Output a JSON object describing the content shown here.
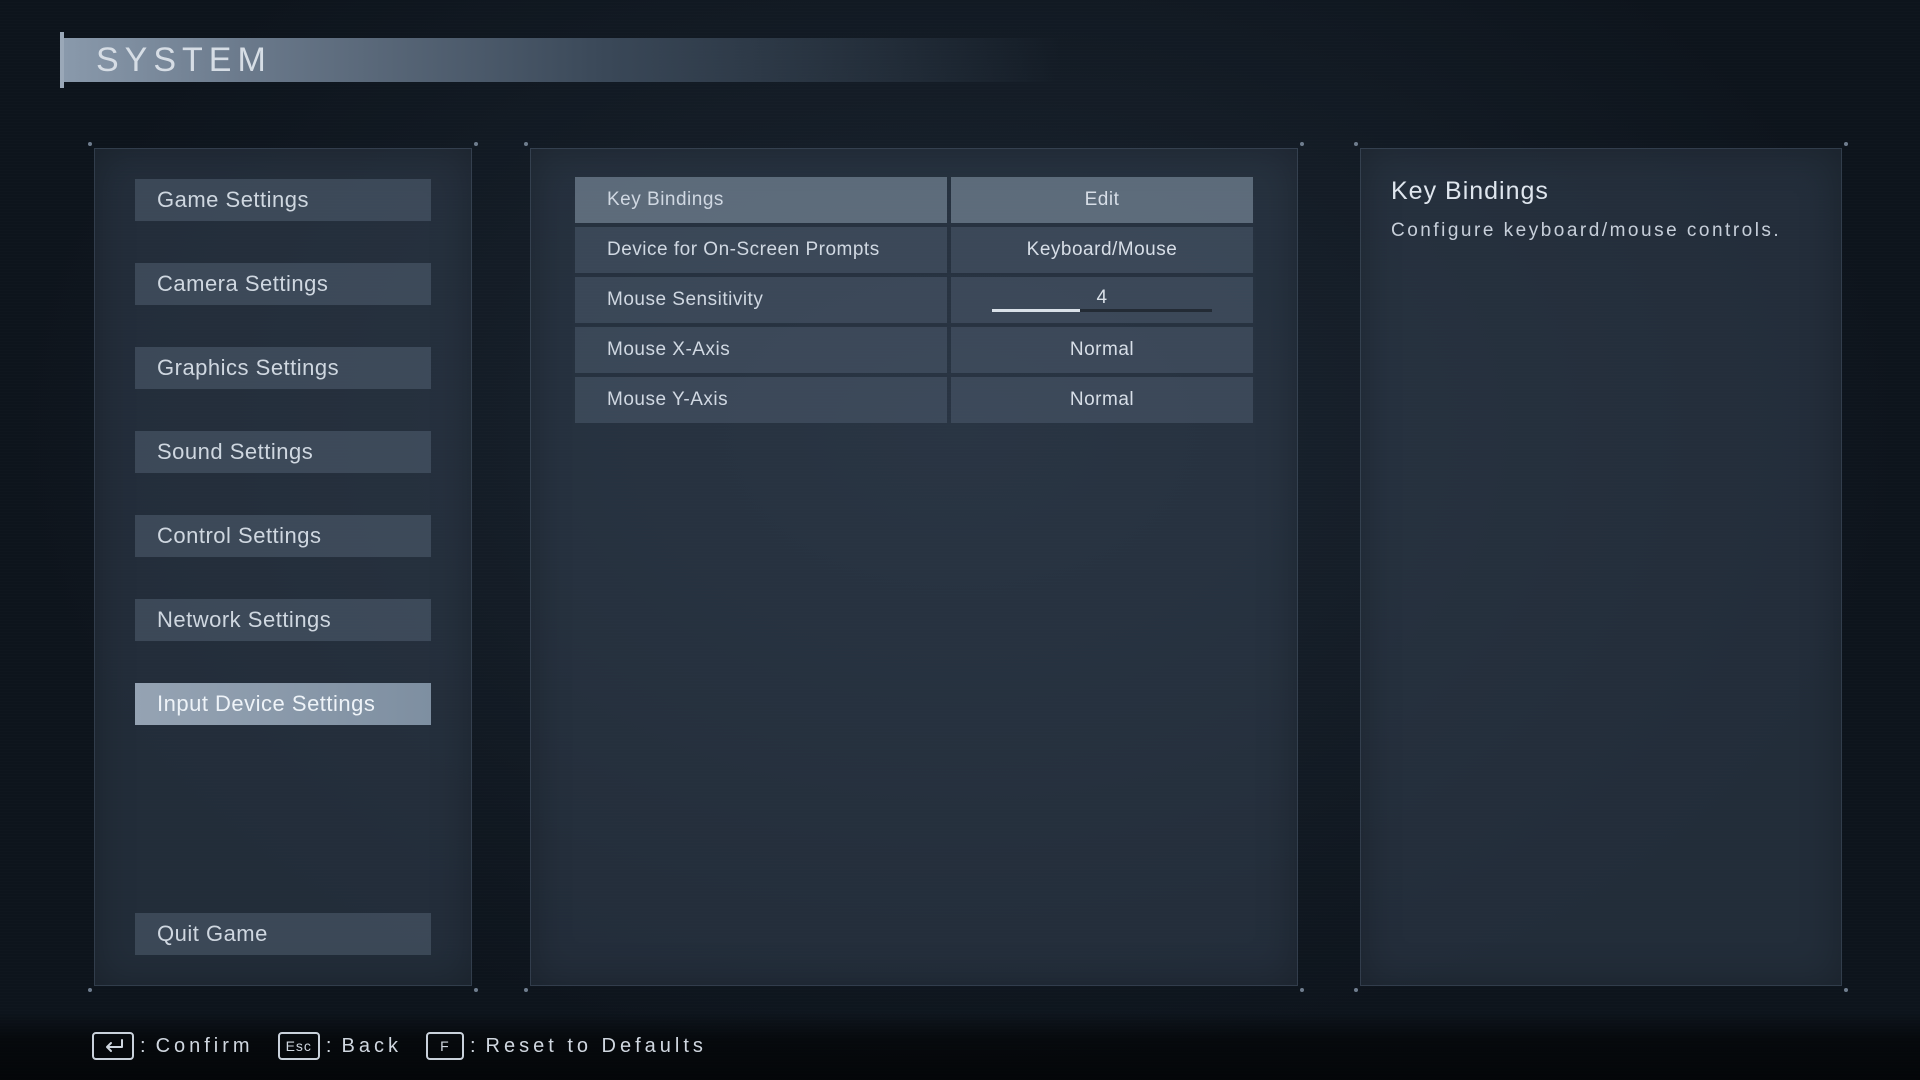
{
  "header": {
    "title": "SYSTEM"
  },
  "sidebar": {
    "items": [
      {
        "label": "Game Settings",
        "active": false
      },
      {
        "label": "Camera Settings",
        "active": false
      },
      {
        "label": "Graphics Settings",
        "active": false
      },
      {
        "label": "Sound Settings",
        "active": false
      },
      {
        "label": "Control Settings",
        "active": false
      },
      {
        "label": "Network Settings",
        "active": false
      },
      {
        "label": "Input Device Settings",
        "active": true
      }
    ],
    "quit_label": "Quit Game"
  },
  "settings": {
    "rows": [
      {
        "label": "Key Bindings",
        "type": "button",
        "value": "Edit",
        "active": true
      },
      {
        "label": "Device for On-Screen Prompts",
        "type": "select",
        "value": "Keyboard/Mouse",
        "active": false
      },
      {
        "label": "Mouse Sensitivity",
        "type": "slider",
        "value": "4",
        "min": 0,
        "max": 10,
        "fill_pct": 40,
        "active": false
      },
      {
        "label": "Mouse X-Axis",
        "type": "select",
        "value": "Normal",
        "active": false
      },
      {
        "label": "Mouse Y-Axis",
        "type": "select",
        "value": "Normal",
        "active": false
      }
    ]
  },
  "description": {
    "title": "Key Bindings",
    "body": "Configure keyboard/mouse controls."
  },
  "footer": {
    "hints": [
      {
        "key": "Enter",
        "display": "enter",
        "action": "Confirm"
      },
      {
        "key": "Esc",
        "display": "Esc",
        "action": "Back"
      },
      {
        "key": "F",
        "display": "F",
        "action": "Reset to Defaults"
      }
    ]
  },
  "colors": {
    "accent": "#8a9aac",
    "panel_bg": "#344252",
    "text": "#cfd7e0"
  }
}
